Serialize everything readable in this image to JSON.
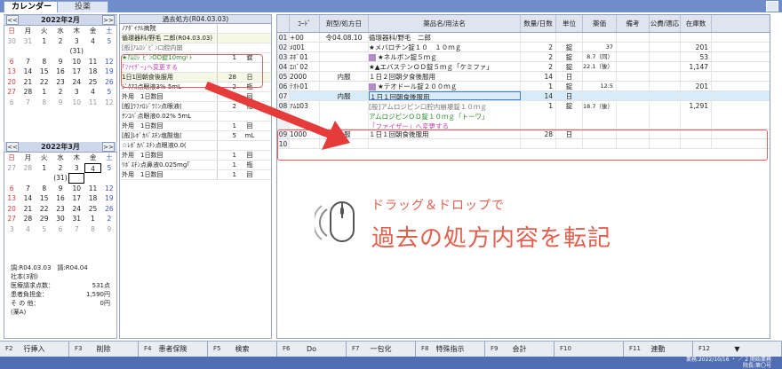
{
  "tabs": {
    "calendar": "カレンダー",
    "dosing": "投薬"
  },
  "cal_feb": {
    "prev": "<<",
    "next": ">>",
    "title": "2022年2月",
    "weekdays": [
      "日",
      "月",
      "火",
      "水",
      "木",
      "金",
      "土"
    ],
    "days": [
      "30",
      "31",
      "1",
      "2",
      "3",
      "4",
      "5",
      "",
      "",
      "",
      "",
      "(31)",
      "",
      "",
      "6",
      "7",
      "8",
      "9",
      "10",
      "11",
      "12",
      "13",
      "14",
      "15",
      "16",
      "17",
      "18",
      "19",
      "20",
      "21",
      "22",
      "23",
      "24",
      "25",
      "26",
      "27",
      "28",
      "1",
      "2",
      "3",
      "4",
      "5",
      "6",
      "7",
      "8",
      "9",
      "10",
      "11",
      "12"
    ]
  },
  "cal_mar": {
    "prev": "<<",
    "next": ">>",
    "title": "2022年3月",
    "weekdays": [
      "日",
      "月",
      "火",
      "水",
      "木",
      "金",
      "土"
    ],
    "days": [
      "27",
      "28",
      "1",
      "2",
      "3",
      "4",
      "5",
      "",
      "",
      "",
      "(31)",
      "",
      "",
      "",
      "6",
      "7",
      "8",
      "9",
      "10",
      "11",
      "12",
      "13",
      "14",
      "15",
      "16",
      "17",
      "18",
      "19",
      "20",
      "21",
      "22",
      "23",
      "24",
      "25",
      "26",
      "27",
      "28",
      "29",
      "30",
      "31",
      "1",
      "2",
      "3",
      "4",
      "5",
      "6",
      "7",
      "8",
      "9"
    ]
  },
  "info": {
    "line1a": "調:R04.03.03",
    "line1b": "請:R04.04",
    "line2": "社本(3割)",
    "l3": "医療請求点数：",
    "v3": "531点",
    "l4": "患者負担金：",
    "v4": "1,590円",
    "l5": "そ の 他：",
    "v5": "0円",
    "line6": "(薬A)"
  },
  "mid": {
    "title": "過去処方(R04.03.03)",
    "rows": [
      {
        "t": "ﾉｱﾀﾞｲﾅﾙ病院",
        "q": "",
        "u": ""
      },
      {
        "t": "循環器科/野毛 二郎(R04.03.03)",
        "q": "",
        "u": ""
      },
      {
        "t": "[般]ｱﾑﾛｼﾞﾋﾟﾝ口腔内崩",
        "q": "",
        "u": ""
      },
      {
        "t": "★ｱﾑﾛｼﾞﾋﾟﾝOD錠10mg｢ﾄ",
        "q": "1",
        "u": "錠"
      },
      {
        "t": "｢ﾌｧｲｻﾞｰ｣へ変更する",
        "q": "",
        "u": ""
      },
      {
        "t": "1日1回朝食後服用",
        "q": "28",
        "u": "日"
      },
      {
        "t": "ｼﾞｸｱｽ点眼液3% 5mL",
        "q": "2",
        "u": "瓶"
      },
      {
        "t": "外用　1日数回",
        "q": "1",
        "u": "回"
      },
      {
        "t": "[般]ﾗﾌｧﾛｼﾞﾗﾐﾝ点眼液(",
        "q": "2",
        "u": "瓶"
      },
      {
        "t": "ｻﾝｺﾊﾞ点眼液0.02% 5mL",
        "q": "",
        "u": ""
      },
      {
        "t": "外用　1日数回",
        "q": "1",
        "u": "回"
      },
      {
        "t": "[般]ﾚﾎﾞｶﾊﾞｽﾁﾝ塩酸塩(",
        "q": "5",
        "u": "mL"
      },
      {
        "t": "☆ﾚﾎﾞｶﾊﾞｽﾁﾝ点眼液0.0(",
        "q": "",
        "u": ""
      },
      {
        "t": "外用　1日数回",
        "q": "1",
        "u": "回"
      },
      {
        "t": "ﾘﾎﾞｽﾁﾝ点鼻液0.025mg｢",
        "q": "1",
        "u": "瓶"
      },
      {
        "t": "外用　1日数回",
        "q": "1",
        "u": "回"
      }
    ]
  },
  "right": {
    "headers": [
      "",
      "ｺｰﾄﾞ",
      "剤型/処方日",
      "薬品名/用法名",
      "数量/日数",
      "単位",
      "薬価",
      "備考",
      "公費/適応",
      "在庫数"
    ],
    "rows": [
      {
        "n": "01",
        "code": "+00",
        "form": "令04.08.10",
        "name": "循環器科/野毛　二郎",
        "qty": "",
        "unit": "",
        "price": "",
        "note": "",
        "pub": "",
        "stock": "",
        "badge": false
      },
      {
        "n": "02",
        "code": "ﾒﾛ01",
        "form": "",
        "name": "★メバロチン錠１０　１０ｍｇ",
        "qty": "2",
        "unit": "錠",
        "price": "37",
        "note": "",
        "pub": "",
        "stock": "201",
        "badge": false
      },
      {
        "n": "03",
        "code": "ﾈﾎﾞ01",
        "form": "",
        "name": "★ネルボン錠５ｍｇ",
        "qty": "2",
        "unit": "錠",
        "price": "8.7（同）",
        "note": "",
        "pub": "",
        "stock": "53",
        "badge": true
      },
      {
        "n": "04",
        "code": "ｴﾊﾞ02",
        "form": "",
        "name": "★▲エバステンＯＤ錠５ｍｇ「ケミファ」",
        "qty": "2",
        "unit": "錠",
        "price": "22.1（後）",
        "note": "",
        "pub": "",
        "stock": "1,147",
        "badge": false
      },
      {
        "n": "05",
        "code": "2000",
        "form": "内服",
        "name": "１日２回朝夕食後服用",
        "qty": "14",
        "unit": "日",
        "price": "",
        "note": "",
        "pub": "",
        "stock": "",
        "badge": false
      },
      {
        "n": "06",
        "code": "ﾃｵﾄ01",
        "form": "",
        "name": "★テオドール錠２００ｍｇ",
        "qty": "1",
        "unit": "錠",
        "price": "12.5",
        "note": "",
        "pub": "",
        "stock": "201",
        "badge": true
      },
      {
        "n": "07",
        "code": "",
        "form": "内服",
        "name": "１日１回朝食後服用",
        "qty": "14",
        "unit": "日",
        "price": "",
        "note": "",
        "pub": "",
        "stock": "",
        "badge": false
      },
      {
        "n": "08",
        "code": "ｱﾑﾛ03",
        "form": "",
        "name1": "[般]アムロジピン口腔内崩壊錠１０ｍｇ",
        "name2": "アムロジピンＯＤ錠１０ｍｇ「トーワ」",
        "name3": "「ファイザー」へ変更する",
        "qty": "1",
        "unit": "錠",
        "price": "18.7（後）",
        "note": "",
        "pub": "",
        "stock": "1,291",
        "badge": false
      },
      {
        "n": "09",
        "code": "1000",
        "form": "内服",
        "name": "１日１回朝食後服用",
        "qty": "28",
        "unit": "日",
        "price": "",
        "note": "",
        "pub": "",
        "stock": "",
        "badge": false
      },
      {
        "n": "10",
        "code": "",
        "form": "",
        "name": "",
        "qty": "",
        "unit": "",
        "price": "",
        "note": "",
        "pub": "",
        "stock": "",
        "badge": false
      }
    ]
  },
  "caption": {
    "line1": "ドラッグ＆ドロップで",
    "line2": "過去の処方内容を転記"
  },
  "fkeys": [
    {
      "k": "F2",
      "l": "行挿入",
      "dis": false
    },
    {
      "k": "F3",
      "l": "削除",
      "dis": false
    },
    {
      "k": "F4",
      "l": "患者保険",
      "dis": false
    },
    {
      "k": "F5",
      "l": "検索",
      "dis": false
    },
    {
      "k": "F6",
      "l": "Do",
      "dis": false
    },
    {
      "k": "F7",
      "l": "一包化",
      "dis": false
    },
    {
      "k": "F8",
      "l": "特殊指示",
      "dis": false
    },
    {
      "k": "F9",
      "l": "会計",
      "dis": false
    },
    {
      "k": "F10",
      "l": "",
      "dis": true
    },
    {
      "k": "F11",
      "l": "連動",
      "dis": false
    },
    {
      "k": "F12",
      "l": "▼",
      "dis": false
    }
  ],
  "status": {
    "line1": "業務:2022/10/16 ・ ／ 2 開始業務",
    "line2": "院長:第〇号"
  },
  "colors": {
    "accent": "#e0604e",
    "header": "#6f8dc9"
  }
}
